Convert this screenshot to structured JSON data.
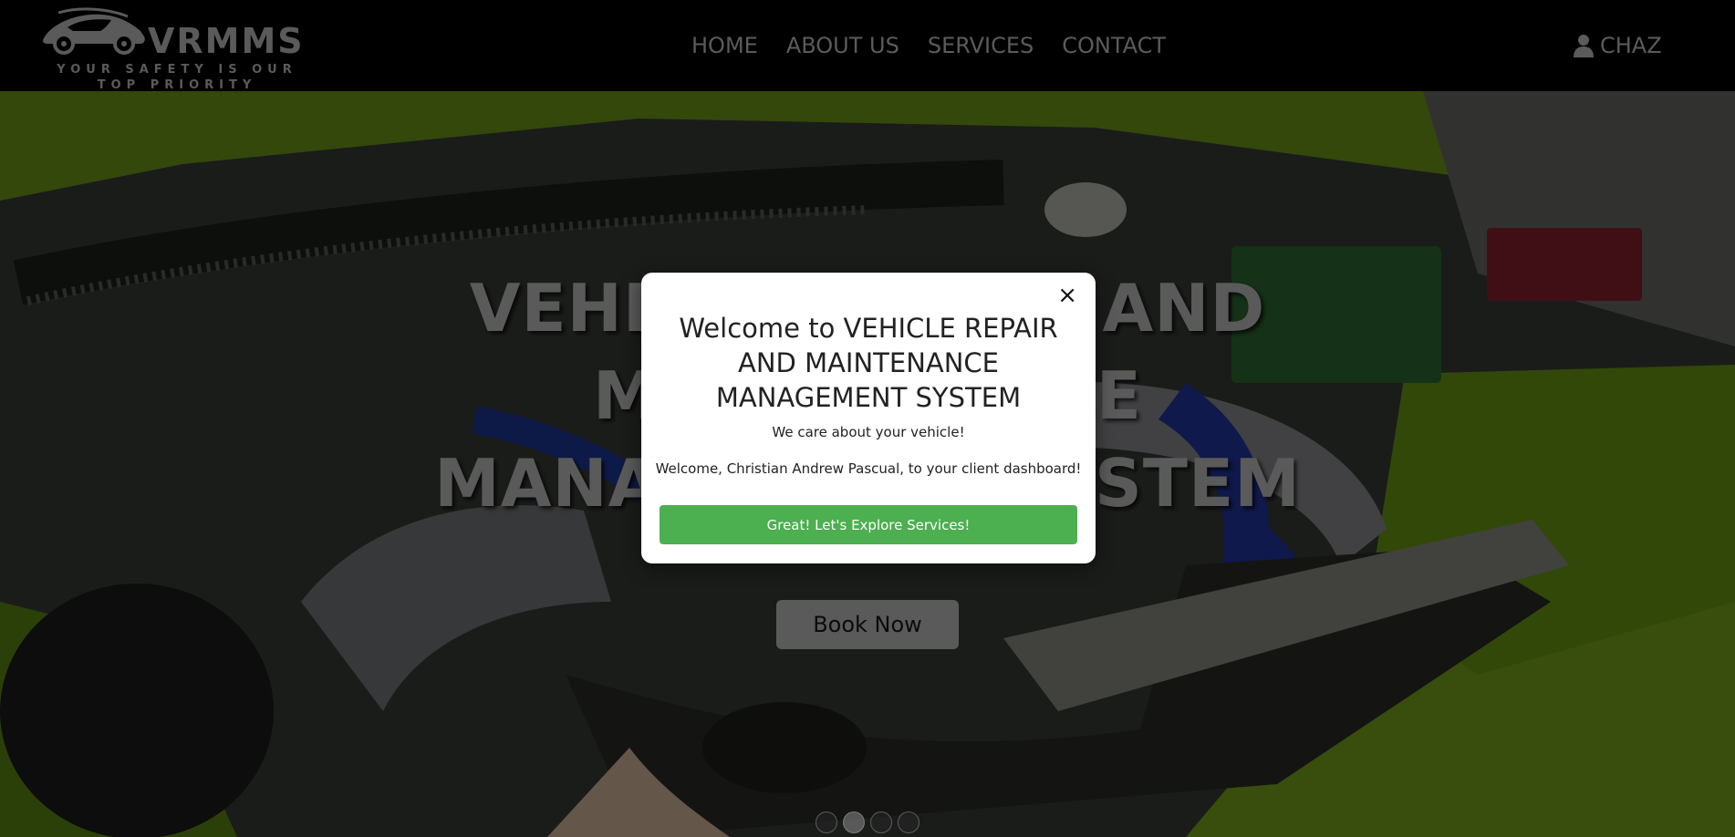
{
  "brand": {
    "name": "VRMMS",
    "tagline_line1": "YOUR SAFETY IS OUR",
    "tagline_line2": "TOP PRIORITY"
  },
  "nav": {
    "links": [
      {
        "label": "HOME"
      },
      {
        "label": "ABOUT US"
      },
      {
        "label": "SERVICES"
      },
      {
        "label": "CONTACT"
      }
    ],
    "user": {
      "name": "CHAZ",
      "icon": "user-icon"
    }
  },
  "hero": {
    "title_lines": [
      "VEHICLE REPAIR AND",
      "MAINTENANCE",
      "MANAGEMENT SYSTEM"
    ],
    "book_button": "Book Now",
    "slide_count": 4,
    "active_slide": 2
  },
  "modal": {
    "close_symbol": "×",
    "title": "Welcome to VEHICLE REPAIR AND MAINTENANCE MANAGEMENT SYSTEM",
    "subtitle": "We care about your vehicle!",
    "message": "Welcome, Christian Andrew Pascual, to your client dashboard!",
    "button": "Great! Let's Explore Services!"
  },
  "colors": {
    "nav_bg": "#000000",
    "nav_text": "#8c8c8c",
    "accent_green": "#4caf50",
    "body_green": "#8fc31f"
  }
}
